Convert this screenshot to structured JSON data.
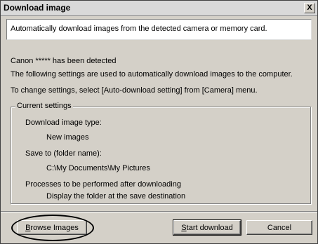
{
  "window": {
    "title": "Download image",
    "close_glyph": "X",
    "close_icon": "close-icon"
  },
  "header": {
    "text": "Automatically download images from the detected camera or memory card."
  },
  "body": {
    "detected": "Canon ***** has been detected",
    "settings_info": "The following settings are used to automatically download images to the computer.",
    "change_info": "To change settings, select [Auto-download setting] from [Camera] menu."
  },
  "current_settings": {
    "legend": "Current settings",
    "type_label": "Download image type:",
    "type_value": "New images",
    "save_label": "Save to (folder name):",
    "save_value": "C:\\My Documents\\My Pictures",
    "process_label": "Processes to be performed after downloading",
    "process_value": "Display the folder at the save destination"
  },
  "buttons": {
    "browse_hotkey": "B",
    "browse_rest": "rowse Images",
    "start_hotkey": "S",
    "start_rest": "tart download",
    "cancel": "Cancel"
  },
  "colors": {
    "dialog_bg": "#d4d0c8",
    "titlebar_bg": "#d9d9d9",
    "panel_bg": "#ffffff"
  }
}
